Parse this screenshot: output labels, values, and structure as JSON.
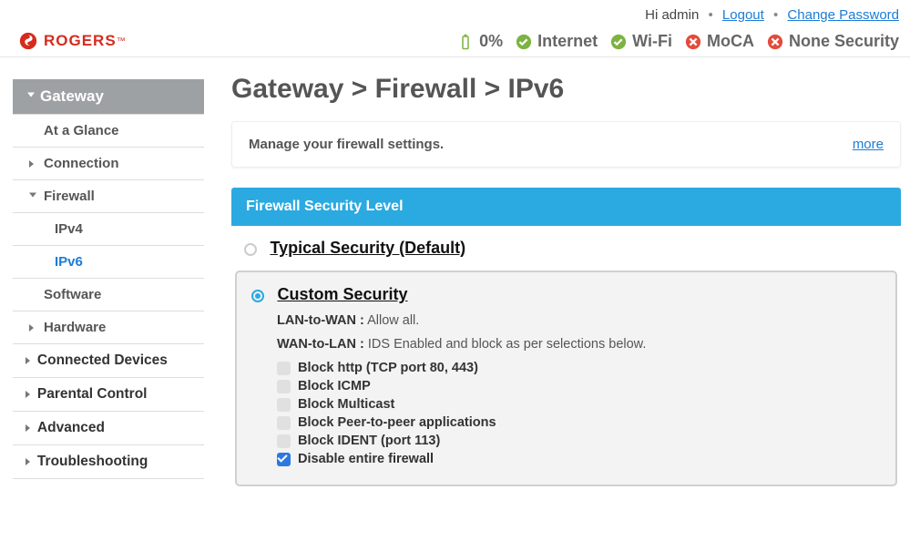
{
  "header": {
    "logo_text": "ROGERS",
    "greeting": "Hi admin",
    "logout": "Logout",
    "change_pw": "Change Password",
    "battery_pct": "0%",
    "status": {
      "internet": "Internet",
      "wifi": "Wi-Fi",
      "moca": "MoCA",
      "security": "None Security"
    }
  },
  "sidebar": {
    "gateway": "Gateway",
    "at_a_glance": "At a Glance",
    "connection": "Connection",
    "firewall": "Firewall",
    "ipv4": "IPv4",
    "ipv6": "IPv6",
    "software": "Software",
    "hardware": "Hardware",
    "connected_devices": "Connected Devices",
    "parental_control": "Parental Control",
    "advanced": "Advanced",
    "troubleshooting": "Troubleshooting"
  },
  "main": {
    "breadcrumb": "Gateway > Firewall > IPv6",
    "info_msg": "Manage your firewall settings.",
    "more": "more",
    "panel_title": "Firewall Security Level",
    "typical_label": "Typical Security (Default)",
    "custom_label": "Custom Security",
    "lan_to_wan_label": "LAN-to-WAN :",
    "lan_to_wan_value": "Allow all.",
    "wan_to_lan_label": "WAN-to-LAN :",
    "wan_to_lan_value": "IDS Enabled and block as per selections below.",
    "checks": {
      "http": "Block http (TCP port 80, 443)",
      "icmp": "Block ICMP",
      "multicast": "Block Multicast",
      "p2p": "Block Peer-to-peer applications",
      "ident": "Block IDENT (port 113)",
      "disable": "Disable entire firewall"
    }
  }
}
